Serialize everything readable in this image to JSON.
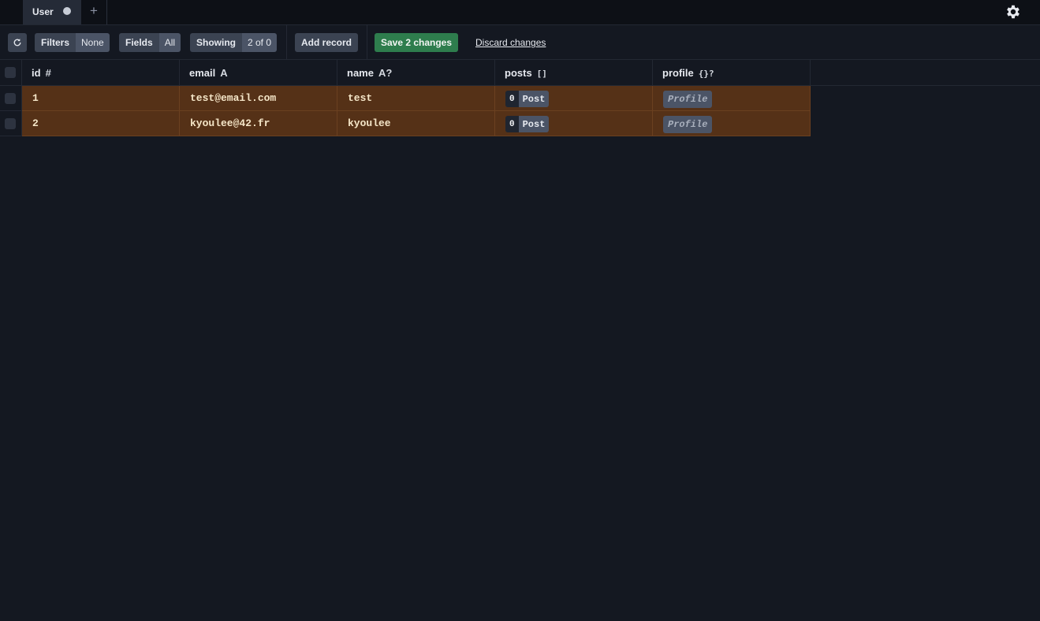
{
  "tabs": [
    {
      "label": "User",
      "unsaved": true
    }
  ],
  "toolbar": {
    "filters_label": "Filters",
    "filters_value": "None",
    "fields_label": "Fields",
    "fields_value": "All",
    "showing_label": "Showing",
    "showing_value": "2 of 0",
    "add_record_label": "Add record",
    "save_label": "Save 2 changes",
    "discard_label": "Discard changes"
  },
  "columns": [
    {
      "name": "id",
      "type": "#"
    },
    {
      "name": "email",
      "type": "A"
    },
    {
      "name": "name",
      "type": "A?"
    },
    {
      "name": "posts",
      "type": "[]"
    },
    {
      "name": "profile",
      "type": "{}?"
    }
  ],
  "rows": [
    {
      "id": "1",
      "email": "test@email.com",
      "name": "test",
      "posts_count": "0",
      "posts_label": "Post",
      "profile_label": "Profile"
    },
    {
      "id": "2",
      "email": "kyoulee@42.fr",
      "name": "kyoulee",
      "posts_count": "0",
      "posts_label": "Post",
      "profile_label": "Profile"
    }
  ],
  "colors": {
    "modified_row": "#553117",
    "save_button": "#2e7d4d",
    "background": "#141821"
  }
}
